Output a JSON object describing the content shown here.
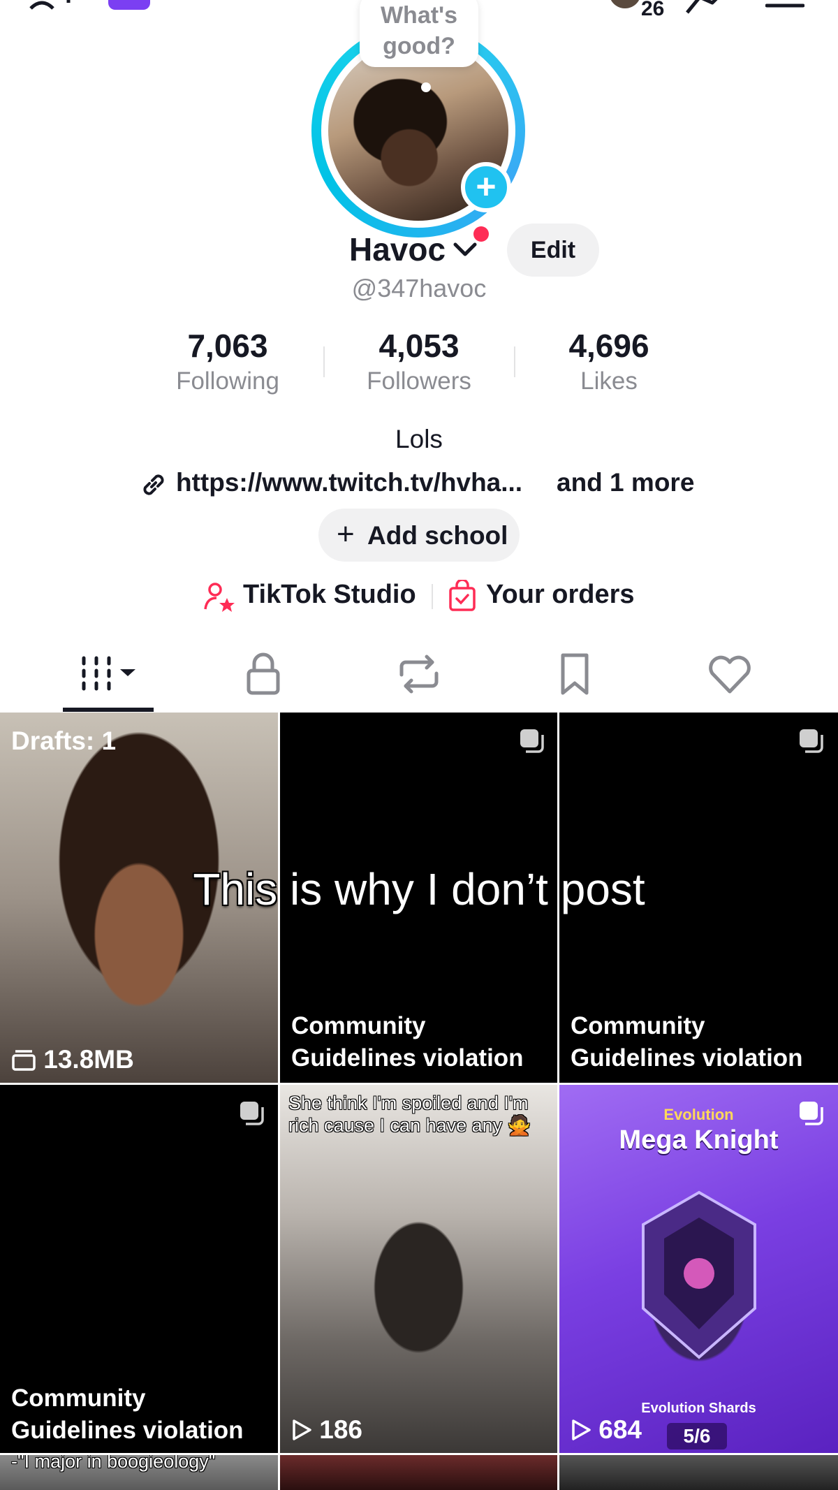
{
  "top_bar": {
    "notification_count": "26",
    "icons": [
      "add-friend-icon",
      "share-icon",
      "menu-icon"
    ]
  },
  "profile": {
    "status_bubble": "What's good?",
    "display_name": "Havoc",
    "edit_label": "Edit",
    "handle": "@347havoc",
    "avatar_badge": "+"
  },
  "stats": [
    {
      "value": "7,063",
      "label": "Following"
    },
    {
      "value": "4,053",
      "label": "Followers"
    },
    {
      "value": "4,696",
      "label": "Likes"
    }
  ],
  "bio": "Lols",
  "link": {
    "url": "https://www.twitch.tv/hvha...",
    "more": "and 1 more"
  },
  "add_school": {
    "plus": "+",
    "label": "Add school"
  },
  "shortcuts": {
    "studio": "TikTok Studio",
    "orders": "Your orders"
  },
  "tabs": [
    "videos",
    "private",
    "reposts",
    "favorites",
    "liked"
  ],
  "grid": {
    "draft": {
      "label": "Drafts: 1",
      "size": "13.8MB"
    },
    "violation_line1": "Community",
    "violation_line2": "Guidelines violation",
    "video5": {
      "caption": "She think I'm spoiled and I'm rich cause I can have any 🙅",
      "views": "186"
    },
    "video6": {
      "top": "Evolution",
      "title": "Mega Knight",
      "bottom": "Evolution Shards",
      "views": "684",
      "page": "5/6"
    },
    "row3_caption": "-\"I major in boogieology\""
  },
  "overlay_text": "This is why I don’t post",
  "colors": {
    "accent": "#fe2c55",
    "ring": "#20d5ec",
    "plus": "#20c2f0"
  }
}
